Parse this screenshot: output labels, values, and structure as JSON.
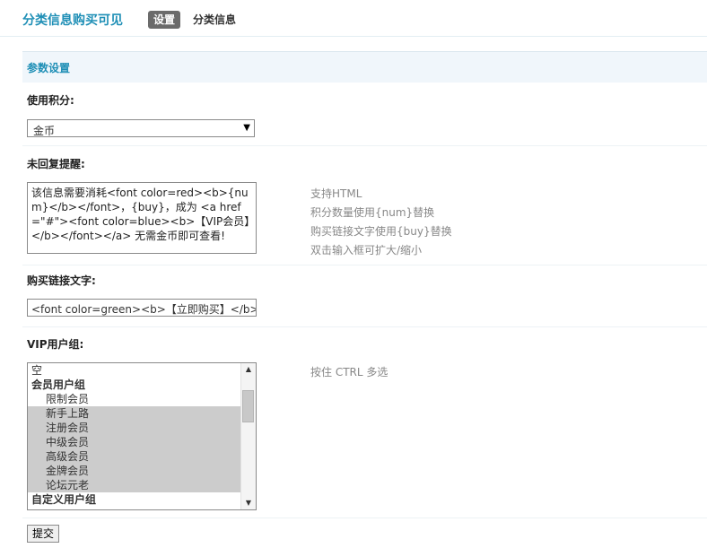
{
  "header": {
    "title": "分类信息购买可见",
    "tabs": [
      "设置",
      "分类信息"
    ]
  },
  "section": {
    "title": "参数设置"
  },
  "credit": {
    "label": "使用积分:",
    "selected": "金币"
  },
  "reply_notice": {
    "label": "未回复提醒:",
    "value": "该信息需要消耗<font color=red><b>{num}</b></font>，{buy}，成为 <a href=\"#\"><font color=blue><b>【VIP会员】</b></font></a> 无需金币即可查看!",
    "hints": [
      "支持HTML",
      "积分数量使用{num}替换",
      "购买链接文字使用{buy}替换",
      "双击输入框可扩大/缩小"
    ]
  },
  "buy_link": {
    "label": "购买链接文字:",
    "value": "<font color=green><b>【立即购买】</b></font>"
  },
  "vip_groups": {
    "label": "VIP用户组:",
    "hint": "按住 CTRL 多选",
    "options": [
      {
        "text": "空",
        "kind": "plain",
        "selected": false
      },
      {
        "text": "会员用户组",
        "kind": "group",
        "selected": false
      },
      {
        "text": "限制会员",
        "kind": "child",
        "selected": false
      },
      {
        "text": "新手上路",
        "kind": "child",
        "selected": true
      },
      {
        "text": "注册会员",
        "kind": "child",
        "selected": true
      },
      {
        "text": "中级会员",
        "kind": "child",
        "selected": true
      },
      {
        "text": "高级会员",
        "kind": "child",
        "selected": true
      },
      {
        "text": "金牌会员",
        "kind": "child",
        "selected": true
      },
      {
        "text": "论坛元老",
        "kind": "child",
        "selected": true
      },
      {
        "text": "自定义用户组",
        "kind": "group",
        "selected": false
      }
    ]
  },
  "submit_label": "提交"
}
